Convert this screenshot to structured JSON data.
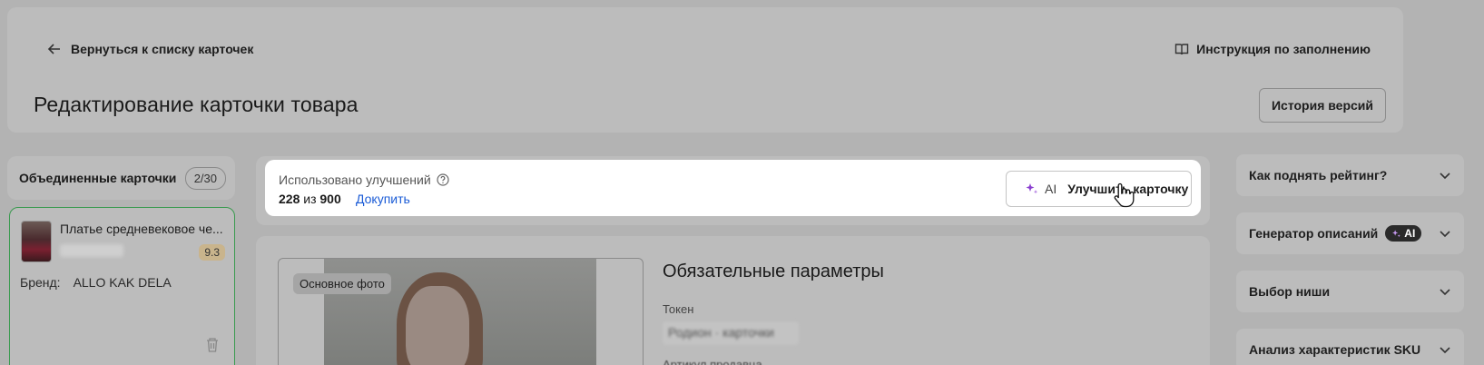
{
  "header": {
    "back_label": "Вернуться к списку карточек",
    "instructions_label": "Инструкция по заполнению",
    "title": "Редактирование карточки товара",
    "history_button": "История версий"
  },
  "merged": {
    "title": "Объединенные карточки",
    "count": "2/30",
    "card": {
      "name": "Платье средневековое че...",
      "rating": "9.3",
      "brand_label": "Бренд:",
      "brand_value": "ALLO KAK DELA"
    }
  },
  "improve": {
    "used_label": "Использовано улучшений",
    "used_value": "228",
    "of_text": "из",
    "total_value": "900",
    "buy_label": "Докупить",
    "ai_tag": "AI",
    "button_label": "Улучшить карточку"
  },
  "params": {
    "photo_badge": "Основное фото",
    "title": "Обязательные параметры",
    "token_label": "Токен",
    "token_value": "Родион · карточки",
    "article_label": "Артикул продавца"
  },
  "sidebar_right": {
    "items": [
      {
        "label": "Как поднять рейтинг?"
      },
      {
        "label": "Генератор описаний",
        "badge": "AI"
      },
      {
        "label": "Выбор ниши"
      },
      {
        "label": "Анализ характеристик SKU"
      }
    ]
  },
  "colors": {
    "overlay": "#b3b3b3",
    "link": "#1a5bd6",
    "card_border_active": "#3a9a4f",
    "ai_sparkle": "#8b3fd0"
  }
}
